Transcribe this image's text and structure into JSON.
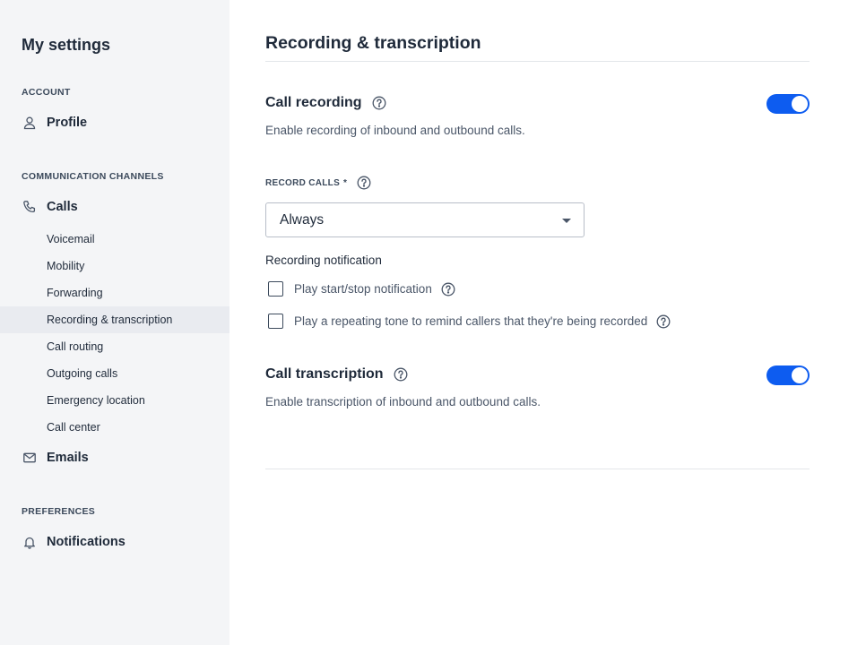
{
  "sidebar": {
    "title": "My settings",
    "sections": {
      "account": "ACCOUNT",
      "channels": "COMMUNICATION CHANNELS",
      "preferences": "PREFERENCES"
    },
    "profile": "Profile",
    "calls": "Calls",
    "call_subitems": [
      "Voicemail",
      "Mobility",
      "Forwarding",
      "Recording & transcription",
      "Call routing",
      "Outgoing calls",
      "Emergency location",
      "Call center"
    ],
    "active_subitem": "Recording & transcription",
    "emails": "Emails",
    "notifications": "Notifications"
  },
  "main": {
    "title": "Recording & transcription",
    "call_recording": {
      "title": "Call recording",
      "description": "Enable recording of inbound and outbound calls.",
      "enabled": true
    },
    "record_calls": {
      "label": "RECORD CALLS",
      "required_mark": "*",
      "value": "Always"
    },
    "recording_notification": {
      "title": "Recording notification",
      "options": [
        {
          "label": "Play start/stop notification",
          "checked": false
        },
        {
          "label": "Play a repeating tone to remind callers that they're being recorded",
          "checked": false
        }
      ]
    },
    "call_transcription": {
      "title": "Call transcription",
      "description": "Enable transcription of inbound and outbound calls.",
      "enabled": true
    }
  },
  "colors": {
    "accent": "#0d5cf0",
    "sidebar_bg": "#f4f5f7",
    "active_bg": "#e9ebf0"
  }
}
